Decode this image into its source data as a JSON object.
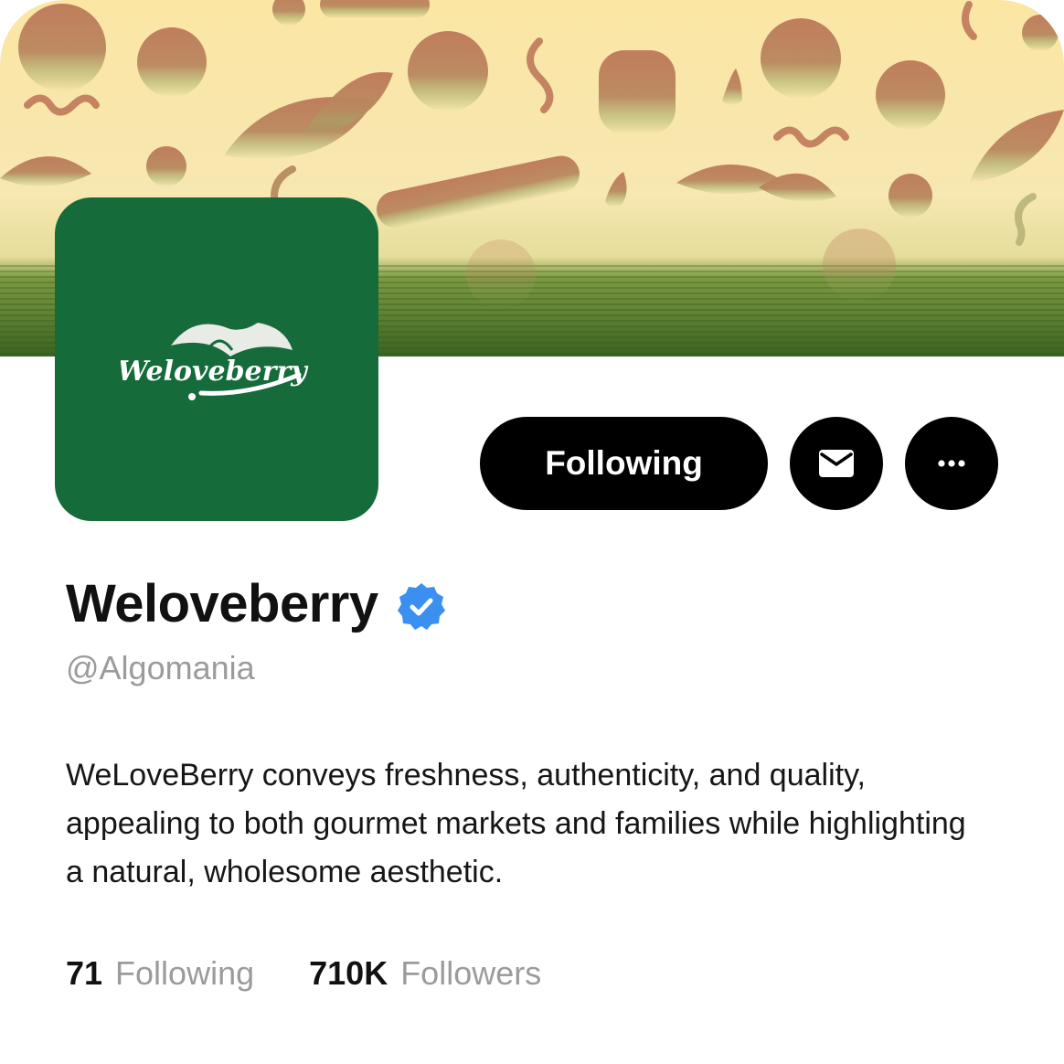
{
  "profile": {
    "name": "Weloveberry",
    "handle": "@Algomania",
    "verified": true,
    "logo_text": "Weloveberry",
    "bio": "WeLoveBerry conveys freshness, authenticity, and quality, appealing to both gourmet markets and families while highlighting a natural, wholesome aesthetic."
  },
  "actions": {
    "follow_label": "Following",
    "message_icon": "mail-icon",
    "more_icon": "more-horizontal-icon"
  },
  "stats": {
    "following_count": "71",
    "following_label": "Following",
    "followers_count": "710K",
    "followers_label": "Followers"
  },
  "colors": {
    "brand_green": "#156b3a",
    "verified_blue": "#3b8ff0",
    "button_black": "#000000",
    "muted_text": "#9b9b9b"
  }
}
